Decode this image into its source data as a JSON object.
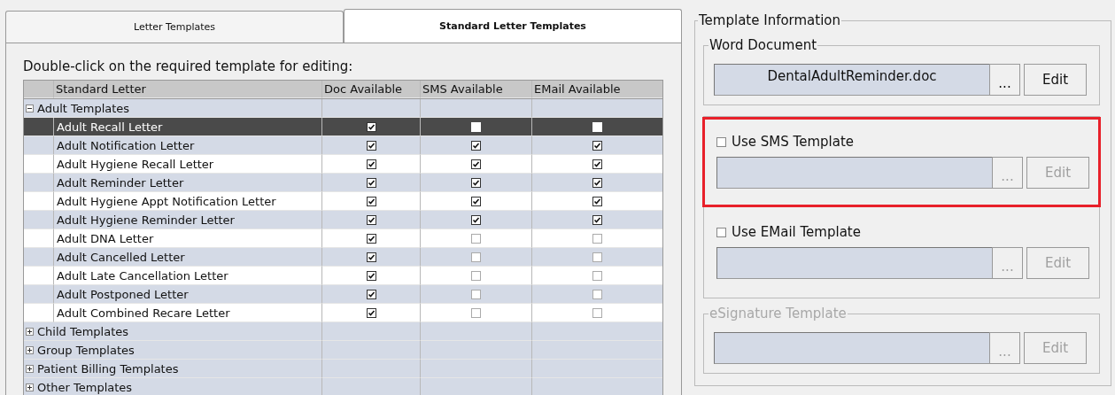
{
  "tabs": [
    {
      "label": "Letter Templates",
      "selected": false
    },
    {
      "label": "Standard Letter Templates",
      "selected": true
    }
  ],
  "instruction": "Double-click on the required template for editing:",
  "table": {
    "columns": [
      "Standard Letter",
      "Doc Available",
      "SMS Available",
      "EMail Available"
    ],
    "groups": [
      {
        "label": "Adult Templates",
        "expanded": true,
        "children": [
          {
            "name": "Adult Recall Letter",
            "selected": true,
            "doc": true,
            "sms": false,
            "email": false
          },
          {
            "name": "Adult Notification Letter",
            "selected": false,
            "doc": true,
            "sms": true,
            "email": true
          },
          {
            "name": "Adult Hygiene Recall Letter",
            "selected": false,
            "doc": true,
            "sms": true,
            "email": true
          },
          {
            "name": "Adult Reminder Letter",
            "selected": false,
            "doc": true,
            "sms": true,
            "email": true
          },
          {
            "name": "Adult Hygiene Appt Notification Letter",
            "selected": false,
            "doc": true,
            "sms": true,
            "email": true
          },
          {
            "name": "Adult Hygiene Reminder Letter",
            "selected": false,
            "doc": true,
            "sms": true,
            "email": true
          },
          {
            "name": "Adult DNA Letter",
            "selected": false,
            "doc": true,
            "sms": false,
            "email": false
          },
          {
            "name": "Adult Cancelled Letter",
            "selected": false,
            "doc": true,
            "sms": false,
            "email": false
          },
          {
            "name": "Adult Late Cancellation Letter",
            "selected": false,
            "doc": true,
            "sms": false,
            "email": false
          },
          {
            "name": "Adult Postponed Letter",
            "selected": false,
            "doc": true,
            "sms": false,
            "email": false
          },
          {
            "name": "Adult Combined Recare Letter",
            "selected": false,
            "doc": true,
            "sms": false,
            "email": false
          }
        ]
      },
      {
        "label": "Child Templates",
        "expanded": false
      },
      {
        "label": "Group Templates",
        "expanded": false
      },
      {
        "label": "Patient Billing Templates",
        "expanded": false
      },
      {
        "label": "Other Templates",
        "expanded": false
      }
    ]
  },
  "template_info": {
    "title": "Template Information",
    "word_document": {
      "legend": "Word Document",
      "value": "DentalAdultReminder.doc",
      "browse": "...",
      "edit": "Edit",
      "disabled": false
    },
    "options": [
      {
        "label": "Use SMS Template",
        "checked": false,
        "highlighted": true,
        "browse": "...",
        "edit": "Edit",
        "disabled": true
      },
      {
        "label": "Use EMail Template",
        "checked": false,
        "highlighted": false,
        "browse": "...",
        "edit": "Edit",
        "disabled": true
      }
    ],
    "esignature": {
      "legend": "eSignature Template",
      "browse": "...",
      "edit": "Edit",
      "disabled": true
    }
  }
}
